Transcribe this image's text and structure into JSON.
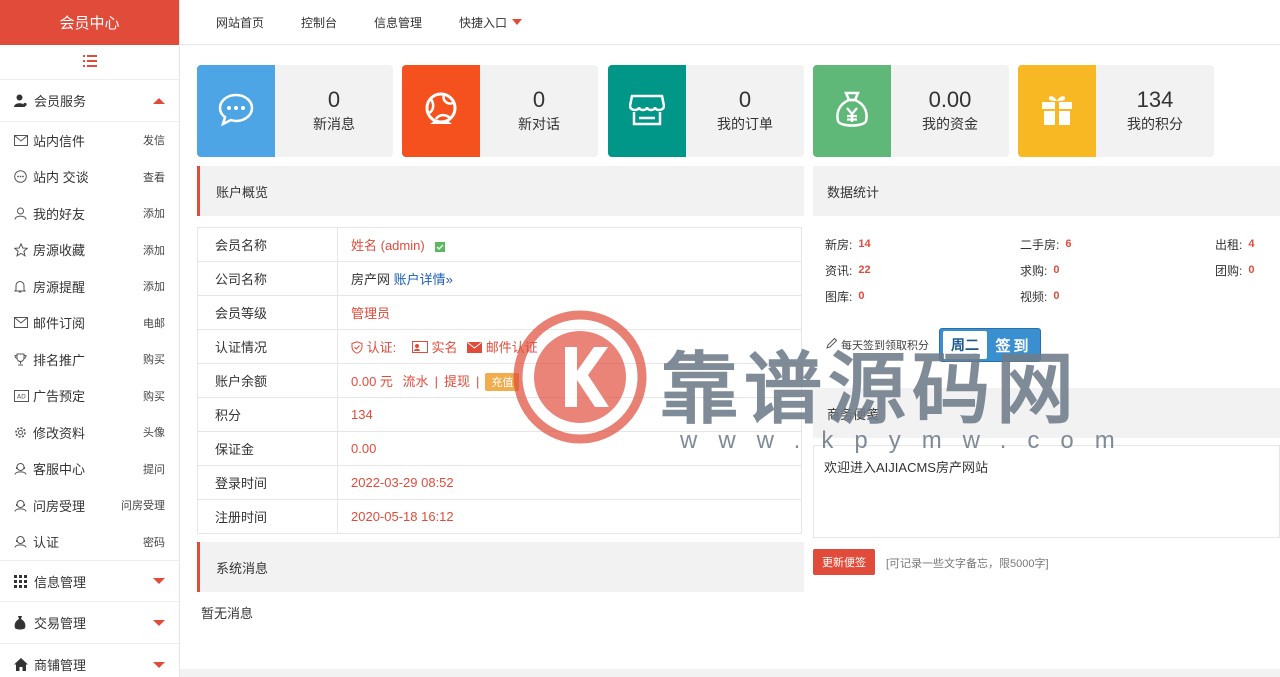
{
  "brand": "会员中心",
  "topnav": [
    {
      "label": "网站首页"
    },
    {
      "label": "控制台"
    },
    {
      "label": "信息管理"
    },
    {
      "label": "快捷入口"
    }
  ],
  "sidebar": {
    "groups": [
      {
        "title": "会员服务",
        "icon": "user-icon",
        "expanded": true
      },
      {
        "title": "信息管理",
        "icon": "grid-icon",
        "expanded": false
      },
      {
        "title": "交易管理",
        "icon": "money-bag-icon",
        "expanded": false
      },
      {
        "title": "商铺管理",
        "icon": "home-icon",
        "expanded": false
      }
    ],
    "items": [
      {
        "label": "站内信件",
        "action": "发信",
        "icon": "envelope-icon"
      },
      {
        "label": "站内 交谈",
        "action": "查看",
        "icon": "chat-icon"
      },
      {
        "label": "我的好友",
        "action": "添加",
        "icon": "user-outline-icon"
      },
      {
        "label": "房源收藏",
        "action": "添加",
        "icon": "star-icon"
      },
      {
        "label": "房源提醒",
        "action": "添加",
        "icon": "bell-icon"
      },
      {
        "label": "邮件订阅",
        "action": "电邮",
        "icon": "envelope-icon"
      },
      {
        "label": "排名推广",
        "action": "购买",
        "icon": "trophy-icon"
      },
      {
        "label": "广告预定",
        "action": "购买",
        "icon": "ad-icon"
      },
      {
        "label": "修改资料",
        "action": "头像",
        "icon": "gear-icon"
      },
      {
        "label": "客服中心",
        "action": "提问",
        "icon": "headset-icon"
      },
      {
        "label": "问房受理",
        "action": "问房受理",
        "icon": "headset-icon"
      },
      {
        "label": "认证",
        "action": "密码",
        "icon": "headset-icon"
      }
    ]
  },
  "stats": [
    {
      "value": "0",
      "label": "新消息",
      "color": "#4ea5e6",
      "icon": "message-bubble-icon"
    },
    {
      "value": "0",
      "label": "新对话",
      "color": "#f4511e",
      "icon": "globe-icon"
    },
    {
      "value": "0",
      "label": "我的订单",
      "color": "#009688",
      "icon": "store-icon"
    },
    {
      "value": "0.00",
      "label": "我的资金",
      "color": "#5fb878",
      "icon": "money-bag-icon"
    },
    {
      "value": "134",
      "label": "我的积分",
      "color": "#f7b824",
      "icon": "gift-icon"
    }
  ],
  "account": {
    "title": "账户概览",
    "rows": {
      "name": {
        "key": "会员名称",
        "value": "姓名 (admin)"
      },
      "company": {
        "key": "公司名称",
        "value": "房产网",
        "link": "账户详情»"
      },
      "level": {
        "key": "会员等级",
        "value": "管理员"
      },
      "cert": {
        "key": "认证情况",
        "label": "认证:",
        "real": "实名",
        "email": "邮件认证"
      },
      "balance": {
        "key": "账户余额",
        "value": "0.00 元",
        "flow": "流水",
        "withdraw": "提现",
        "recharge": "充值"
      },
      "points": {
        "key": "积分",
        "value": "134"
      },
      "deposit": {
        "key": "保证金",
        "value": "0.00"
      },
      "login": {
        "key": "登录时间",
        "value": "2022-03-29 08:52"
      },
      "register": {
        "key": "注册时间",
        "value": "2020-05-18 16:12"
      }
    }
  },
  "datastats": {
    "title": "数据统计",
    "rows": [
      [
        {
          "label": "新房:",
          "value": "14"
        },
        {
          "label": "二手房:",
          "value": "6"
        },
        {
          "label": "出租:",
          "value": "4"
        }
      ],
      [
        {
          "label": "资讯:",
          "value": "22"
        },
        {
          "label": "求购:",
          "value": "0"
        },
        {
          "label": "团购:",
          "value": "0"
        }
      ],
      [
        {
          "label": "图库:",
          "value": "0"
        },
        {
          "label": "视频:",
          "value": "0"
        }
      ]
    ],
    "signin_text": "每天签到领取积分",
    "sign_day": "周二",
    "sign_label": "签到"
  },
  "memo": {
    "title": "商务便笺",
    "content": "欢迎进入AIJIACMS房产网站",
    "button": "更新便签",
    "hint": "[可记录一些文字备忘，限5000字]"
  },
  "system": {
    "title": "系统消息",
    "empty": "暂无消息"
  },
  "watermark": {
    "text": "靠谱源码网",
    "url": "www.kpymw.com"
  }
}
